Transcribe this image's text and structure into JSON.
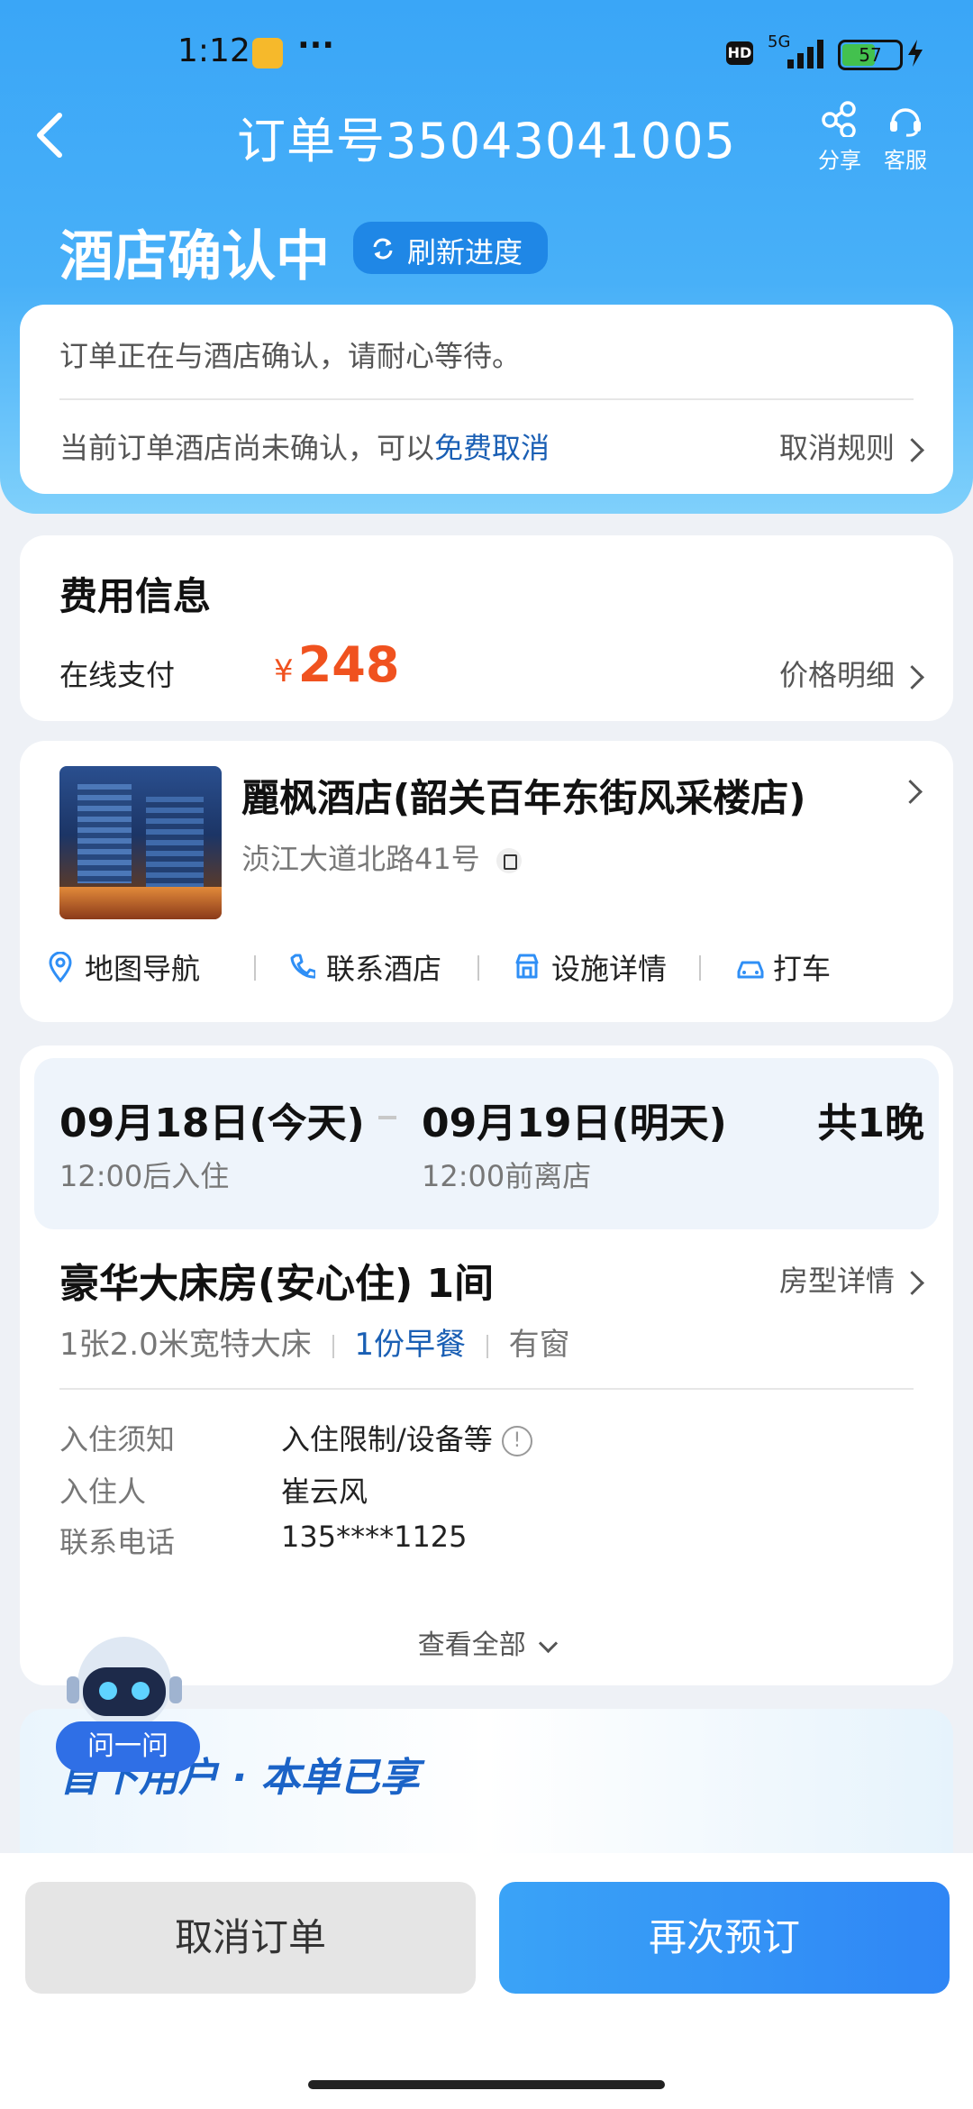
{
  "status_bar": {
    "time": "1:12",
    "dots": "···",
    "network": "5G",
    "hd": "HD",
    "battery": "57"
  },
  "nav": {
    "title": "订单号35043041005",
    "share_label": "分享",
    "service_label": "客服"
  },
  "status": {
    "title": "酒店确认中",
    "refresh_label": "刷新进度",
    "message": "订单正在与酒店确认，请耐心等待。",
    "cancel_note": "当前订单酒店尚未确认，可以",
    "free_cancel_link": "免费取消",
    "cancel_rule_label": "取消规则"
  },
  "fee": {
    "title": "费用信息",
    "method": "在线支付",
    "currency": "¥",
    "amount": "248",
    "detail_label": "价格明细"
  },
  "hotel": {
    "name": "麗枫酒店(韶关百年东街风采楼店)",
    "address": "浈江大道北路41号",
    "actions": [
      {
        "label": "地图导航"
      },
      {
        "label": "联系酒店"
      },
      {
        "label": "设施详情"
      },
      {
        "label": "打车"
      }
    ]
  },
  "stay": {
    "checkin_date": "09月18日(今天)",
    "checkin_time": "12:00后入住",
    "checkout_date": "09月19日(明天)",
    "checkout_time": "12:00前离店",
    "nights": "共1晚",
    "room_title": "豪华大床房(安心住) 1间",
    "room_detail_label": "房型详情",
    "bed": "1张2.0米宽特大床",
    "breakfast": "1份早餐",
    "window": "有窗",
    "info_rows": [
      {
        "label": "入住须知",
        "value": "入住限制/设备等"
      },
      {
        "label": "入住人",
        "value": "崔云风"
      },
      {
        "label": "联系电话",
        "value": "135****1125"
      }
    ],
    "view_all_label": "查看全部"
  },
  "promo": {
    "text": "首下用户 · 本单已享",
    "assistant_label": "问一问"
  },
  "bottom": {
    "cancel_label": "取消订单",
    "rebook_label": "再次预订"
  },
  "colors": {
    "accent": "#2f8ff6",
    "price": "#f0521f",
    "link": "#1a5fb4"
  }
}
